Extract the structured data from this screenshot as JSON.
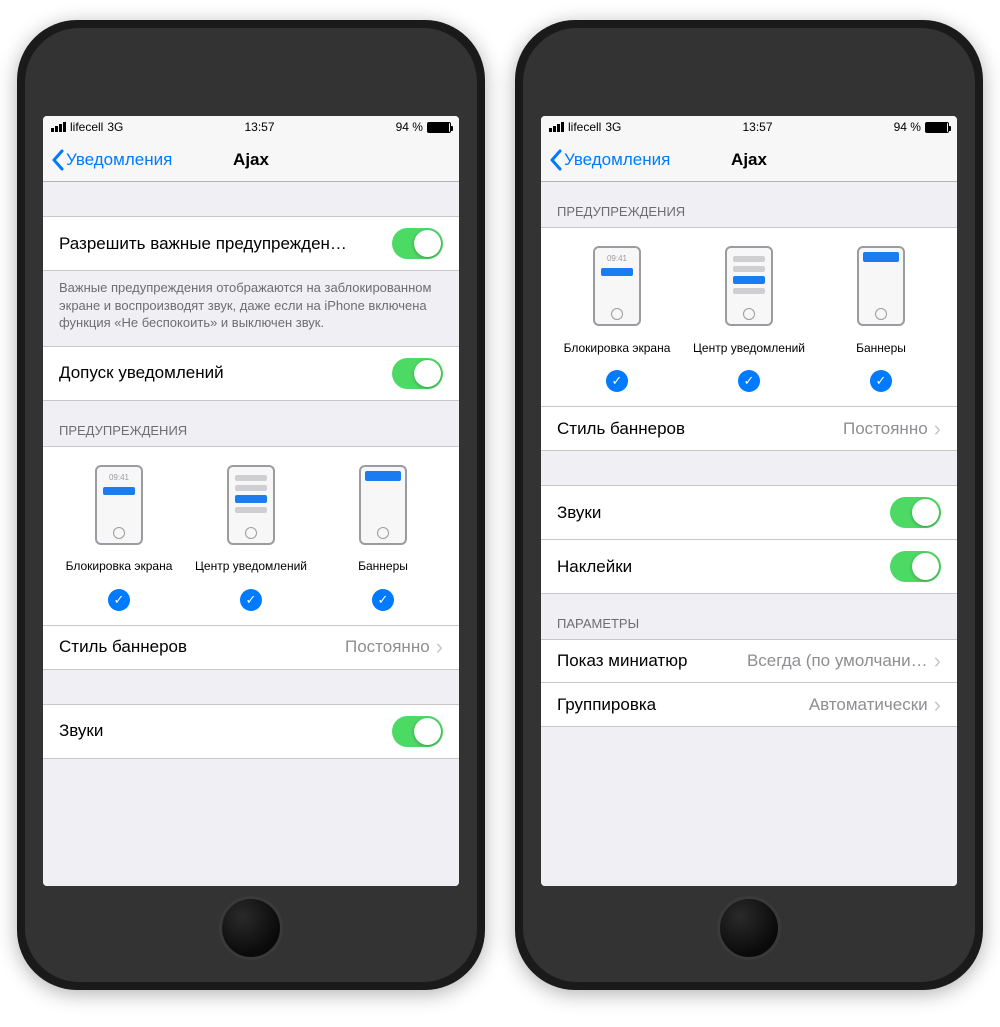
{
  "status": {
    "carrier": "lifecell",
    "network": "3G",
    "time": "13:57",
    "battery_pct": "94 %"
  },
  "nav": {
    "back": "Уведомления",
    "title": "Ajax"
  },
  "left": {
    "critical_label": "Разрешить важные предупрежден…",
    "critical_note": "Важные предупреждения отображаются на заблокированном экране и воспроизводят звук, даже если на iPhone включена функция «Не беспокоить» и выключен звук.",
    "allow_label": "Допуск уведомлений",
    "section_alerts": "ПРЕДУПРЕЖДЕНИЯ",
    "alert_lock": "Блокировка экрана",
    "alert_center": "Центр уведомлений",
    "alert_banner": "Баннеры",
    "lock_time": "09:41",
    "banner_style_label": "Стиль баннеров",
    "banner_style_value": "Постоянно",
    "sounds_label": "Звуки"
  },
  "right": {
    "section_alerts": "ПРЕДУПРЕЖДЕНИЯ",
    "alert_lock": "Блокировка экрана",
    "alert_center": "Центр уведомлений",
    "alert_banner": "Баннеры",
    "lock_time": "09:41",
    "banner_style_label": "Стиль баннеров",
    "banner_style_value": "Постоянно",
    "sounds_label": "Звуки",
    "badges_label": "Наклейки",
    "section_params": "ПАРАМЕТРЫ",
    "previews_label": "Показ миниатюр",
    "previews_value": "Всегда (по умолчани…",
    "grouping_label": "Группировка",
    "grouping_value": "Автоматически"
  }
}
